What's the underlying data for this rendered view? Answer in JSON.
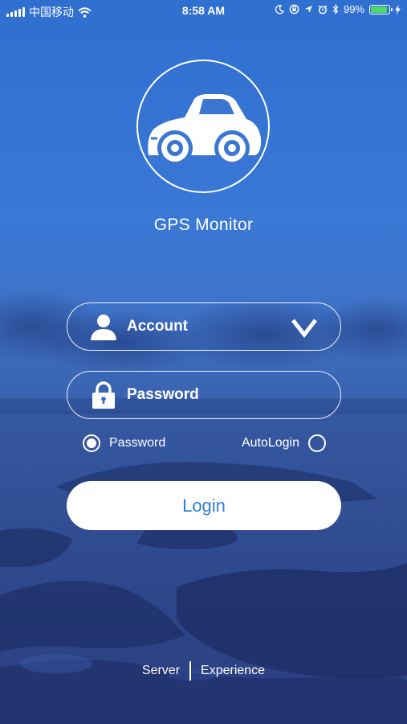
{
  "status_bar": {
    "carrier": "中国移动",
    "time": "8:58 AM",
    "battery": "99%",
    "battery_level": 0.99,
    "icons": [
      "signal-icon",
      "wifi-icon",
      "moon-icon",
      "lock-rotation-icon",
      "location-icon",
      "alarm-icon",
      "bluetooth-icon",
      "battery-icon",
      "charging-icon"
    ]
  },
  "app": {
    "logo_icon": "car-icon",
    "title": "GPS Monitor"
  },
  "login_form": {
    "account_label": "Account",
    "password_label": "Password",
    "remember_password_label": "Password",
    "remember_password_checked": true,
    "auto_login_label": "AutoLogin",
    "auto_login_checked": false,
    "login_button": "Login"
  },
  "footer": {
    "server_link": "Server",
    "experience_link": "Experience"
  },
  "colors": {
    "accent": "#2f7fd8",
    "battery_fill": "#4cd964"
  }
}
